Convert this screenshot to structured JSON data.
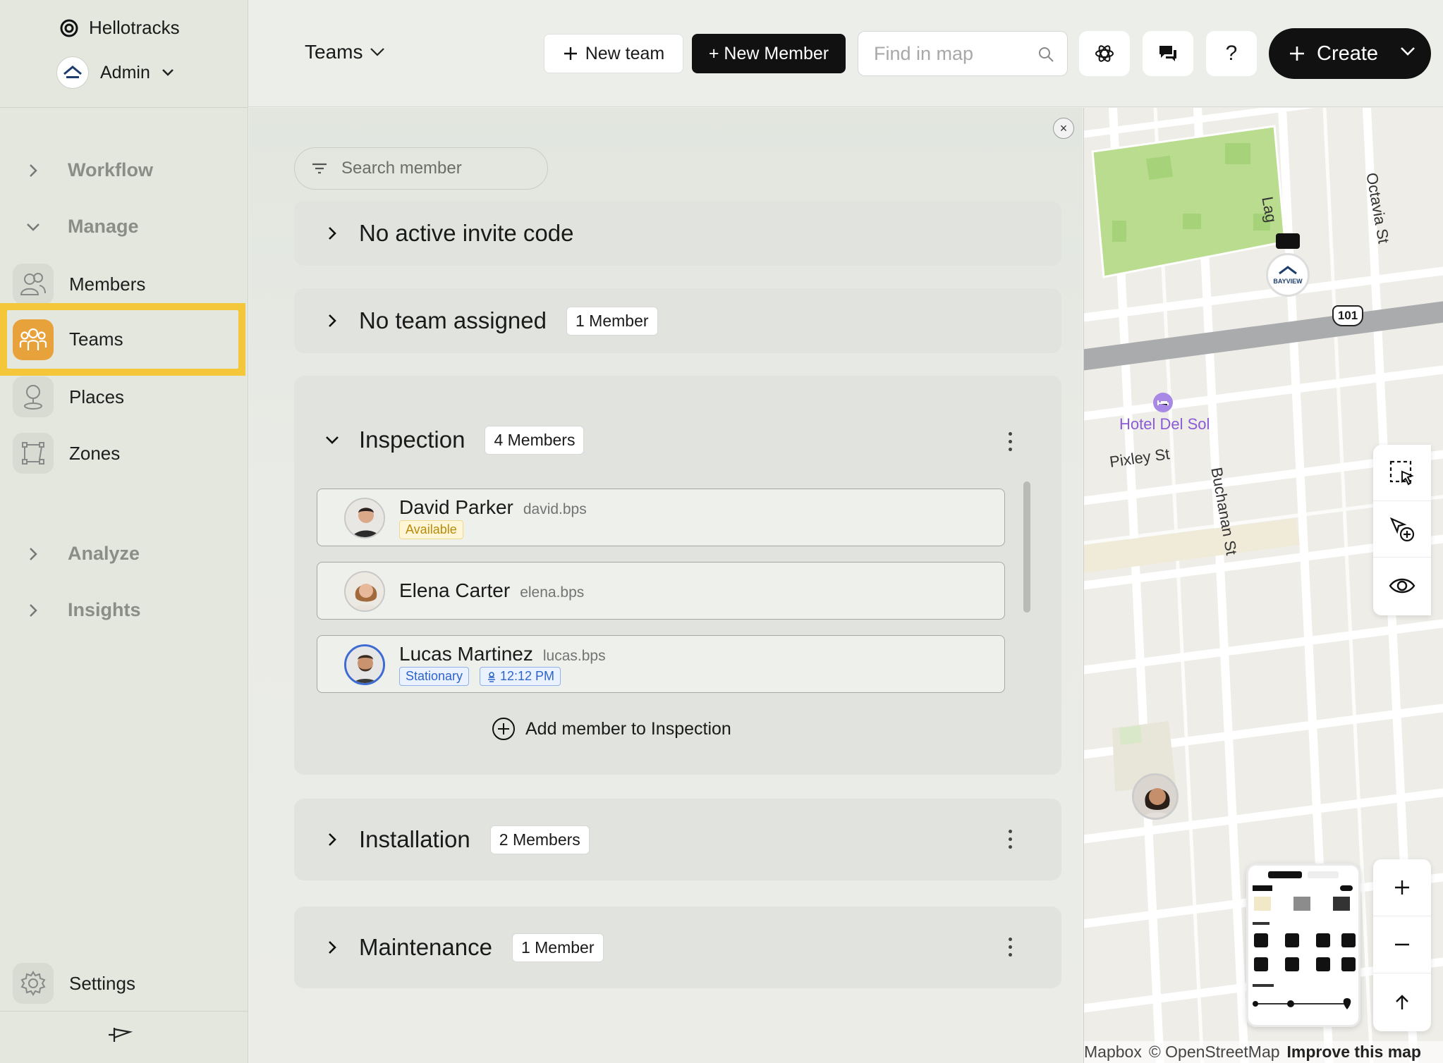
{
  "app": {
    "org_name": "Hellotracks",
    "role": "Admin"
  },
  "sidebar": {
    "sections": [
      {
        "label": "Workflow"
      },
      {
        "label": "Manage"
      },
      {
        "label": "Analyze"
      },
      {
        "label": "Insights"
      }
    ],
    "items": [
      {
        "label": "Members"
      },
      {
        "label": "Teams"
      },
      {
        "label": "Places"
      },
      {
        "label": "Zones"
      }
    ],
    "settings_label": "Settings"
  },
  "topbar": {
    "view_selector": "Teams",
    "new_team_label": "New team",
    "new_member_label": "+ New Member",
    "find_placeholder": "Find in map",
    "help_label": "?",
    "create_label": "Create"
  },
  "panel": {
    "search_placeholder": "Search member",
    "groups": [
      {
        "title": "No active invite code"
      },
      {
        "title": "No team assigned",
        "badge": "1 Member"
      },
      {
        "title": "Inspection",
        "badge": "4 Members",
        "members": [
          {
            "name": "David Parker",
            "username": "david.bps",
            "status": "Available"
          },
          {
            "name": "Elena Carter",
            "username": "elena.bps"
          },
          {
            "name": "Lucas Martinez",
            "username": "lucas.bps",
            "status": "Stationary",
            "time": "12:12 PM"
          }
        ],
        "add_label": "Add member to Inspection"
      },
      {
        "title": "Installation",
        "badge": "2 Members"
      },
      {
        "title": "Maintenance",
        "badge": "1 Member"
      }
    ]
  },
  "map": {
    "labels": {
      "octavia": "Octavia St",
      "laguna": "Lag",
      "highway": "101",
      "hotel": "Hotel Del Sol",
      "pixley": "Pixley St",
      "buchanan": "Buchanan St",
      "company": "BAYVIEW"
    },
    "attribution_mapbox": "Mapbox",
    "attribution_osm": "© OpenStreetMap",
    "attribution_improve": "Improve this map",
    "colors": {
      "park": "#b9dc8e",
      "highway": "#a9abad",
      "hotel": "#8a5bd6"
    }
  }
}
